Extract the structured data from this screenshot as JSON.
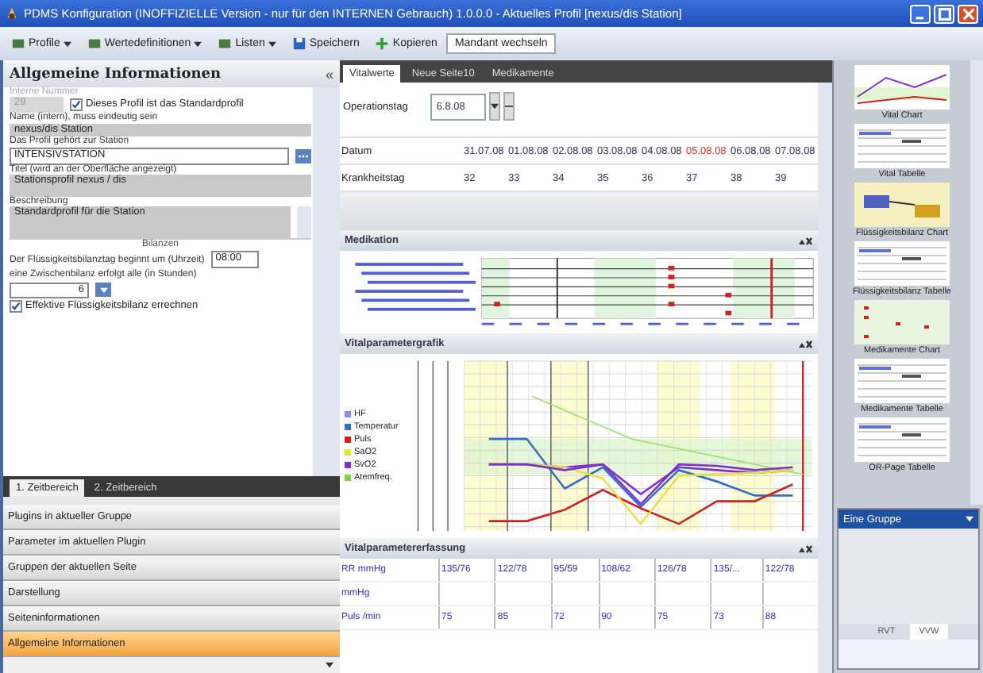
{
  "window": {
    "title": "PDMS Konfiguration (INOFFIZIELLE Version - nur für den INTERNEN Gebrauch) 1.0.0.0 - Aktuelles Profil [nexus/dis Station]"
  },
  "toolbar": [
    {
      "label": "Profile",
      "kind": "dropdown"
    },
    {
      "label": "Wertedefinitionen",
      "kind": "dropdown"
    },
    {
      "label": "Listen",
      "kind": "dropdown"
    },
    {
      "label": "Speichern",
      "kind": "save"
    },
    {
      "label": "Kopieren",
      "kind": "copy"
    },
    {
      "label": "Mandant wechseln",
      "kind": "plain"
    }
  ],
  "left_panel": {
    "title": "Allgemeine Informationen",
    "collapse": "«"
  },
  "general": {
    "number_label": "Interne Nummer",
    "number_value": "29",
    "default_profile": {
      "label": "Dieses Profil ist das Standardprofil",
      "checked": true
    },
    "name_label": "Name (intern), muss eindeutig sein",
    "name_value": "nexus/dis Station",
    "station_label": "Das Profil gehört zur Station",
    "station_value": "INTENSIVSTATION",
    "title_label": "Titel (wird an der Oberfläche angezeigt)",
    "title_value": "Stationsprofil nexus / dis",
    "description_label": "Beschreibung",
    "description_value": "Standardprofil für die Station"
  },
  "balances": {
    "title": "Bilanzen",
    "start_label": "Der Flüssigkeitsbilanztag beginnt um (Uhrzeit)",
    "start_value": "08:00",
    "interval_label": "eine Zwischenbilanz erfolgt alle (in Stunden)",
    "interval_value": "6",
    "effective": {
      "label": "Effektive Flüssigkeitsbilanz errechnen",
      "checked": true
    }
  },
  "time_tabs": [
    {
      "label": "1. Zeitbereich",
      "selected": true
    },
    {
      "label": "2. Zeitbereich",
      "selected": false
    }
  ],
  "accordion": [
    {
      "label": "Plugins in aktueller Gruppe",
      "selected": false
    },
    {
      "label": "Parameter im aktuellen Plugin",
      "selected": false
    },
    {
      "label": "Gruppen der aktuellen Seite",
      "selected": false
    },
    {
      "label": "Darstellung",
      "selected": false
    },
    {
      "label": "Seiteninformationen",
      "selected": false
    },
    {
      "label": "Allgemeine Informationen",
      "selected": true
    }
  ],
  "page_tabs": [
    {
      "label": "Vitalwerte",
      "selected": true
    },
    {
      "label": "Neue Seite10",
      "selected": false
    },
    {
      "label": "Medikamente",
      "selected": false
    }
  ],
  "op_day": {
    "label": "Operationstag",
    "value": "6.8.08"
  },
  "days_table": [
    {
      "label": "Datum",
      "cells": [
        {
          "text": "31.07.08",
          "highlight": false
        },
        {
          "text": "01.08.08",
          "highlight": false
        },
        {
          "text": "02.08.08",
          "highlight": false
        },
        {
          "text": "03.08.08",
          "highlight": false
        },
        {
          "text": "04.08.08",
          "highlight": false
        },
        {
          "text": "05.08.08",
          "highlight": true
        },
        {
          "text": "06.08.08",
          "highlight": false
        },
        {
          "text": "07.08.08",
          "highlight": false
        }
      ]
    },
    {
      "label": "Krankheitstag",
      "cells": [
        {
          "text": "32",
          "highlight": false
        },
        {
          "text": "33",
          "highlight": false
        },
        {
          "text": "34",
          "highlight": false
        },
        {
          "text": "35",
          "highlight": false
        },
        {
          "text": "36",
          "highlight": false
        },
        {
          "text": "37",
          "highlight": false
        },
        {
          "text": "38",
          "highlight": false
        },
        {
          "text": "39",
          "highlight": false
        }
      ]
    }
  ],
  "sections": [
    {
      "title": "Medikation",
      "kind": "medication"
    },
    {
      "title": "Vitalparametergrafik",
      "kind": "vitalchart"
    },
    {
      "title": "Vitalparametererfassung",
      "kind": "vitaltable"
    }
  ],
  "vital_legend": [
    {
      "label": "HF",
      "color": "#8c8cf0"
    },
    {
      "label": "Temperatur",
      "color": "#3070c0"
    },
    {
      "label": "Puls",
      "color": "#d02020"
    },
    {
      "label": "SaO2",
      "color": "#e8e040"
    },
    {
      "label": "SvO2",
      "color": "#8030d0"
    },
    {
      "label": "Atemfreq.",
      "color": "#80d040"
    }
  ],
  "vital_table": [
    {
      "label": "RR mmHg",
      "cells": [
        "135/76",
        "122/78",
        "95/59",
        "108/62",
        "126/78",
        "135/...",
        "122/78"
      ]
    },
    {
      "label": "mmHg"
    },
    {
      "label": "Puls /min",
      "cells": [
        "75",
        "85",
        "72",
        "90",
        "75",
        "73",
        "88"
      ]
    }
  ],
  "templates": [
    {
      "caption": "Vital Chart",
      "kind": "line"
    },
    {
      "caption": "Vital Tabelle",
      "kind": "table"
    },
    {
      "caption": "Flüssigkeitsbilanz Chart",
      "kind": "bars"
    },
    {
      "caption": "Flüssigkeitsbilanz Tabelle",
      "kind": "table"
    },
    {
      "caption": "Medikamente Chart",
      "kind": "dots"
    },
    {
      "caption": "Medikamente Tabelle",
      "kind": "table"
    },
    {
      "caption": "OR-Page Tabelle",
      "kind": "table"
    }
  ],
  "group": {
    "title": "Eine Gruppe",
    "tabs": [
      {
        "label": "RVT",
        "selected": false
      },
      {
        "label": "VVW",
        "selected": true
      }
    ]
  }
}
